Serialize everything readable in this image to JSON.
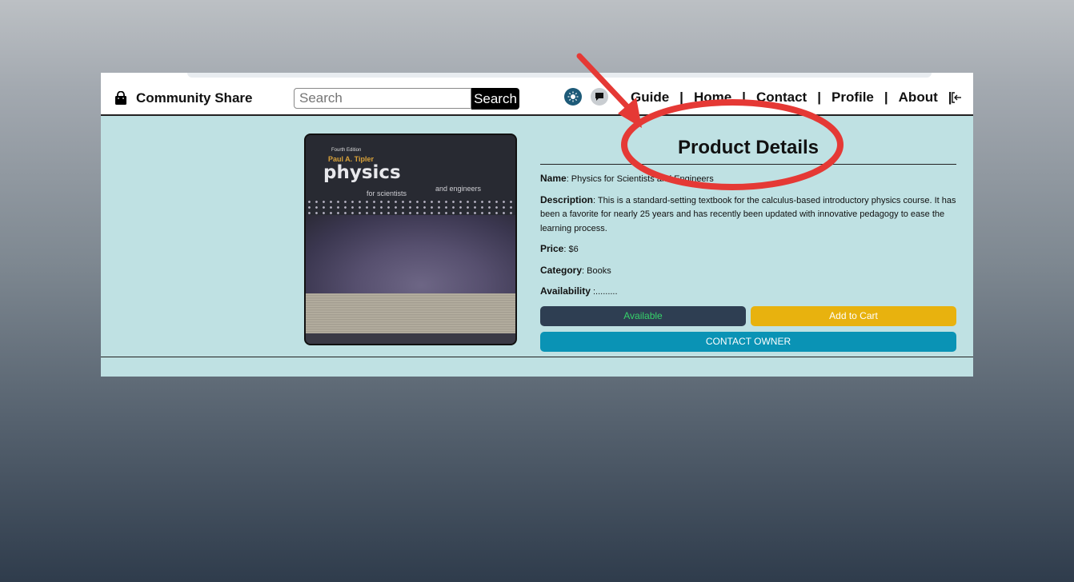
{
  "navbar": {
    "brand": "Community Share",
    "search_placeholder": "Search",
    "search_button": "Search",
    "links": [
      "Guide",
      "Home",
      "Contact",
      "Profile",
      "About"
    ],
    "separator": "|"
  },
  "product": {
    "title": "Product Details",
    "name_label": "Name",
    "name_value": ": Physics for Scientists and Engineers",
    "description_label": "Description",
    "description_value": ": This is a standard-setting textbook for the calculus-based introductory physics course. It has been a favorite for nearly 25 years and has recently been updated with innovative pedagogy to ease the learning process.",
    "price_label": "Price",
    "price_value": ": $6",
    "category_label": "Category",
    "category_value": ": Books",
    "availability_label": "Availability",
    "availability_value": " :.........",
    "available_button": "Available",
    "cart_button": "Add to Cart",
    "contact_button": "CONTACT OWNER"
  },
  "book_cover": {
    "edition": "Fourth Edition",
    "author": "Paul A. Tipler",
    "title": "physics",
    "subtitle_left": "for scientists",
    "subtitle_right": "and engineers"
  },
  "colors": {
    "page_bg": "#bfe1e3",
    "available_bg": "#2e3e52",
    "available_text": "#36d26a",
    "cart_bg": "#e8b20e",
    "contact_bg": "#0a93b5",
    "annotation_red": "#e53935"
  },
  "icons": {
    "brand": "shopping-bag-icon",
    "theme": "sun-icon",
    "chat": "chat-bubble-icon",
    "logout": "logout-icon"
  }
}
